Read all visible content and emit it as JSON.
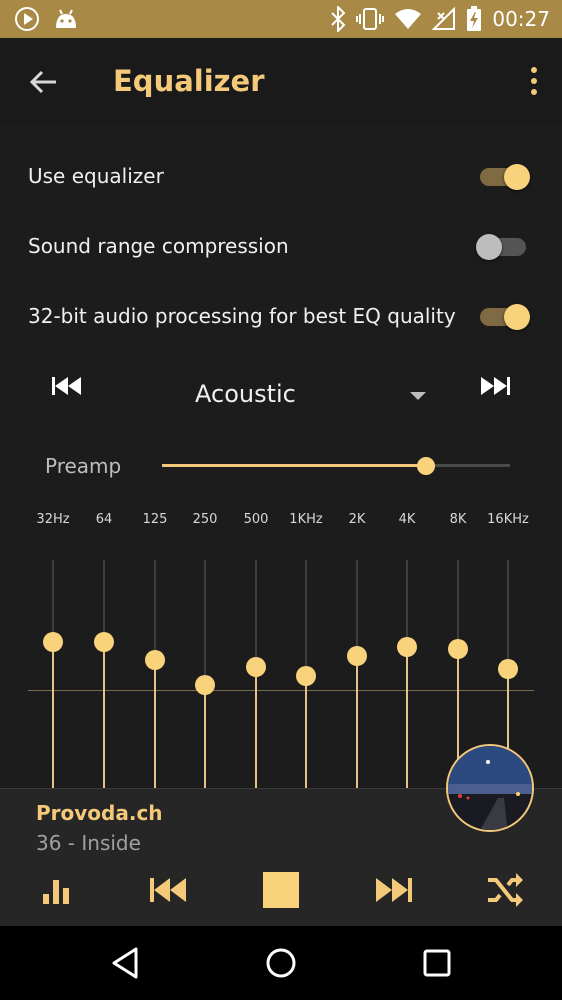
{
  "status_bar": {
    "time": "00:27"
  },
  "app_bar": {
    "title": "Equalizer"
  },
  "settings": [
    {
      "label": "Use equalizer",
      "on": true
    },
    {
      "label": "Sound range compression",
      "on": false
    },
    {
      "label": "32-bit audio processing for best EQ quality",
      "on": true
    }
  ],
  "preset": {
    "selected": "Acoustic"
  },
  "preamp": {
    "label": "Preamp",
    "level": 0.76
  },
  "bands": [
    {
      "label": "32Hz",
      "level": 0.64
    },
    {
      "label": "64",
      "level": 0.64
    },
    {
      "label": "125",
      "level": 0.56
    },
    {
      "label": "250",
      "level": 0.45
    },
    {
      "label": "500",
      "level": 0.53
    },
    {
      "label": "1KHz",
      "level": 0.49
    },
    {
      "label": "2K",
      "level": 0.58
    },
    {
      "label": "4K",
      "level": 0.62
    },
    {
      "label": "8K",
      "level": 0.61
    },
    {
      "label": "16KHz",
      "level": 0.52
    }
  ],
  "now_playing": {
    "title": "Provoda.ch",
    "subtitle": "36 - Inside"
  },
  "colors": {
    "accent": "#f4c97a",
    "status_bar": "#a98946",
    "background": "#1c1c1c"
  }
}
